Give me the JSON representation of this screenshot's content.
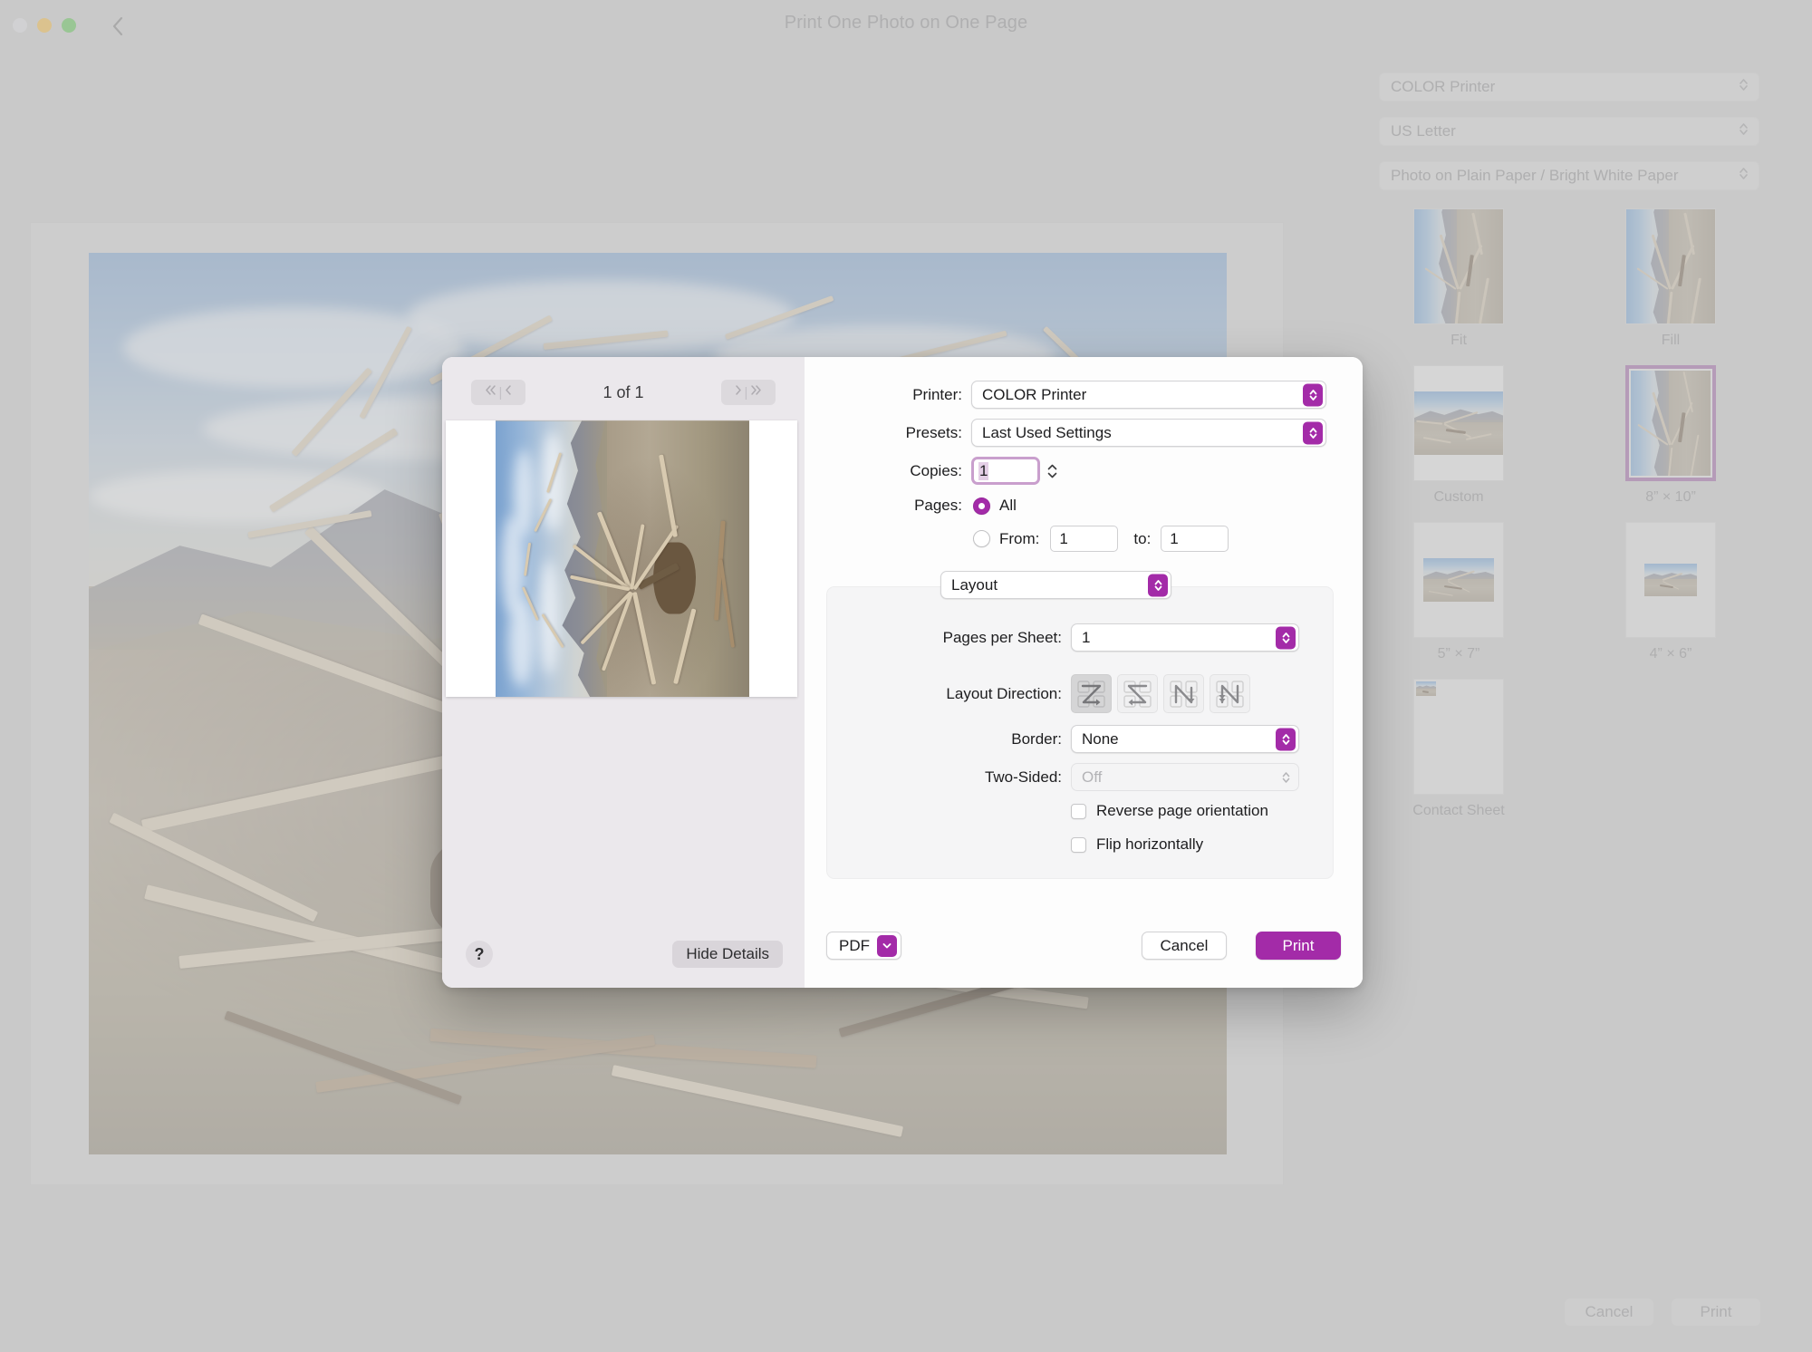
{
  "window": {
    "title": "Print One Photo on One Page",
    "traffic_lights": [
      "close",
      "minimize",
      "zoom"
    ],
    "back_icon": "chevron-left-icon"
  },
  "sidebar": {
    "selects": [
      {
        "name": "printer-select",
        "value": "COLOR Printer"
      },
      {
        "name": "paper-size-select",
        "value": "US Letter"
      },
      {
        "name": "paper-type-select",
        "value": "Photo on Plain Paper / Bright White Paper"
      }
    ],
    "presets": [
      {
        "label": "Fit",
        "selected": false,
        "crop": "portrait"
      },
      {
        "label": "Fill",
        "selected": false,
        "crop": "portrait"
      },
      {
        "label": "Custom",
        "selected": false,
        "crop": "landscape-large"
      },
      {
        "label": "8” × 10”",
        "selected": true,
        "crop": "portrait"
      },
      {
        "label": "5” × 7”",
        "selected": false,
        "crop": "landscape-mid"
      },
      {
        "label": "4” × 6”",
        "selected": false,
        "crop": "landscape-small"
      },
      {
        "label": "Contact Sheet",
        "selected": false,
        "crop": "contact"
      }
    ]
  },
  "background_actions": {
    "cancel_label": "Cancel",
    "print_label": "Print"
  },
  "sheet": {
    "preview": {
      "page_count_label": "1 of 1",
      "prev_first_icon": "double-chevron-left-icon",
      "prev_icon": "chevron-left-icon",
      "next_icon": "chevron-right-icon",
      "next_last_icon": "double-chevron-right-icon",
      "help_label": "?",
      "hide_details_label": "Hide Details"
    },
    "form": {
      "printer_label": "Printer:",
      "printer_value": "COLOR Printer",
      "presets_label": "Presets:",
      "presets_value": "Last Used Settings",
      "copies_label": "Copies:",
      "copies_value": "1",
      "pages_label": "Pages:",
      "pages_all_label": "All",
      "pages_all_selected": true,
      "pages_range_selected": false,
      "pages_from_label": "From:",
      "pages_from_value": "1",
      "pages_to_label": "to:",
      "pages_to_value": "1"
    },
    "layout": {
      "section_value": "Layout",
      "pages_per_sheet_label": "Pages per Sheet:",
      "pages_per_sheet_value": "1",
      "layout_direction_label": "Layout Direction:",
      "layout_directions": [
        {
          "name": "layout-direction-z-right",
          "selected": true
        },
        {
          "name": "layout-direction-z-left",
          "selected": false
        },
        {
          "name": "layout-direction-n-down",
          "selected": false
        },
        {
          "name": "layout-direction-n-up",
          "selected": false
        }
      ],
      "border_label": "Border:",
      "border_value": "None",
      "two_sided_label": "Two-Sided:",
      "two_sided_value": "Off",
      "two_sided_disabled": true,
      "reverse_orientation_label": "Reverse page orientation",
      "reverse_orientation_checked": false,
      "flip_horizontally_label": "Flip horizontally",
      "flip_horizontally_checked": false
    },
    "actions": {
      "pdf_label": "PDF",
      "cancel_label": "Cancel",
      "print_label": "Print"
    }
  },
  "colors": {
    "accent": "#a32ba8",
    "focus_ring": "#c99fcd",
    "selection_border": "#9a5ba0",
    "window_bg": "#c9c9c9",
    "sheet_bg": "#fdfdfd",
    "sheet_left_bg": "#ebe8ec"
  }
}
